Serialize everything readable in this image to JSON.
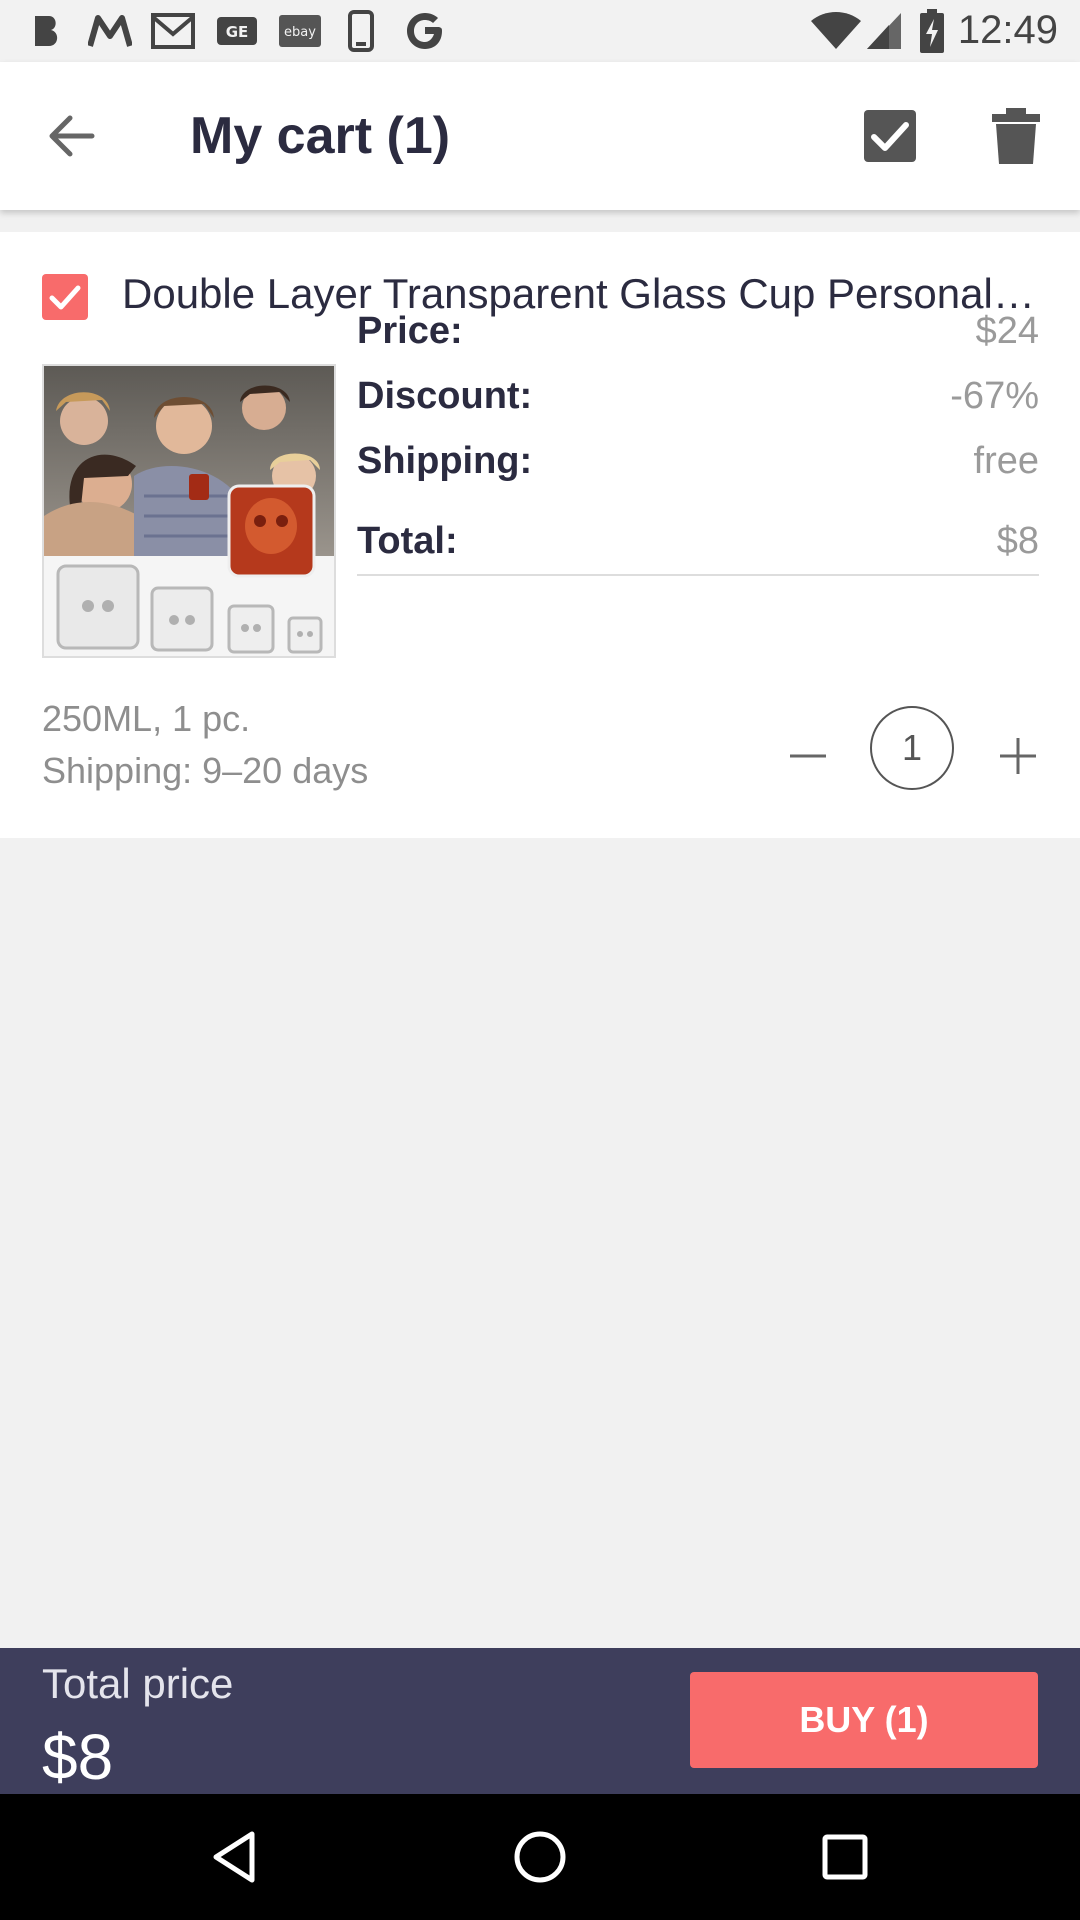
{
  "status_bar": {
    "time": "12:49",
    "icons": [
      "b-icon",
      "m-icon",
      "gmail-icon",
      "ge-icon",
      "ebay-icon",
      "phone-icon",
      "google-icon",
      "wifi-icon",
      "signal-icon",
      "battery-charging-icon"
    ]
  },
  "app_bar": {
    "title": "My cart (1)",
    "back_icon": "arrow-back-icon",
    "select_all_icon": "checkbox-checked-icon",
    "delete_icon": "trash-icon"
  },
  "cart_item": {
    "title": "Double Layer Transparent Glass Cup Personalit…",
    "checked": true,
    "price_label": "Price:",
    "price_value": "$24",
    "discount_label": "Discount:",
    "discount_value": "-67%",
    "shipping_label": "Shipping:",
    "shipping_value": "free",
    "total_label": "Total:",
    "total_value": "$8",
    "variant": "250ML, 1 pc.",
    "shipping_time": "Shipping: 9–20 days",
    "quantity": "1"
  },
  "checkout": {
    "total_label": "Total price",
    "total_value": "$8",
    "buy_label": "BUY (1)"
  },
  "colors": {
    "accent": "#f86b6b",
    "bottom_bar": "#3e3e5c",
    "background": "#f1f1f1"
  }
}
